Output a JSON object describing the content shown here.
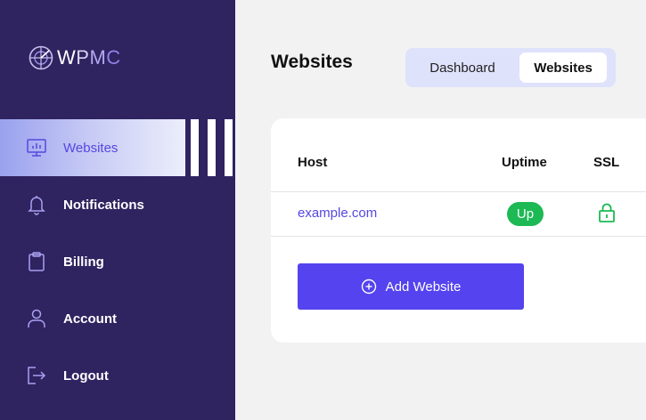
{
  "brand": {
    "logo_icon": "radar-globe-icon",
    "letters": [
      "W",
      "P",
      "M",
      "C"
    ]
  },
  "sidebar": {
    "items": [
      {
        "label": "Websites",
        "icon": "monitor-chart-icon",
        "active": true
      },
      {
        "label": "Notifications",
        "icon": "bell-icon",
        "active": false
      },
      {
        "label": "Billing",
        "icon": "clipboard-icon",
        "active": false
      },
      {
        "label": "Account",
        "icon": "user-icon",
        "active": false
      },
      {
        "label": "Logout",
        "icon": "logout-icon",
        "active": false
      }
    ]
  },
  "header": {
    "title": "Websites",
    "tabs": [
      {
        "label": "Dashboard",
        "active": false
      },
      {
        "label": "Websites",
        "active": true
      }
    ]
  },
  "table": {
    "columns": [
      "Host",
      "Uptime",
      "SSL"
    ],
    "rows": [
      {
        "host": "example.com",
        "uptime": "Up",
        "ssl_icon": "lock-icon"
      }
    ]
  },
  "actions": {
    "add_label": "Add Website",
    "add_icon": "plus-circle-icon"
  },
  "colors": {
    "sidebar_bg": "#2f2360",
    "accent": "#5443ee",
    "link": "#5548e0",
    "success": "#1db954",
    "tabs_bg": "#dfe2fb"
  }
}
